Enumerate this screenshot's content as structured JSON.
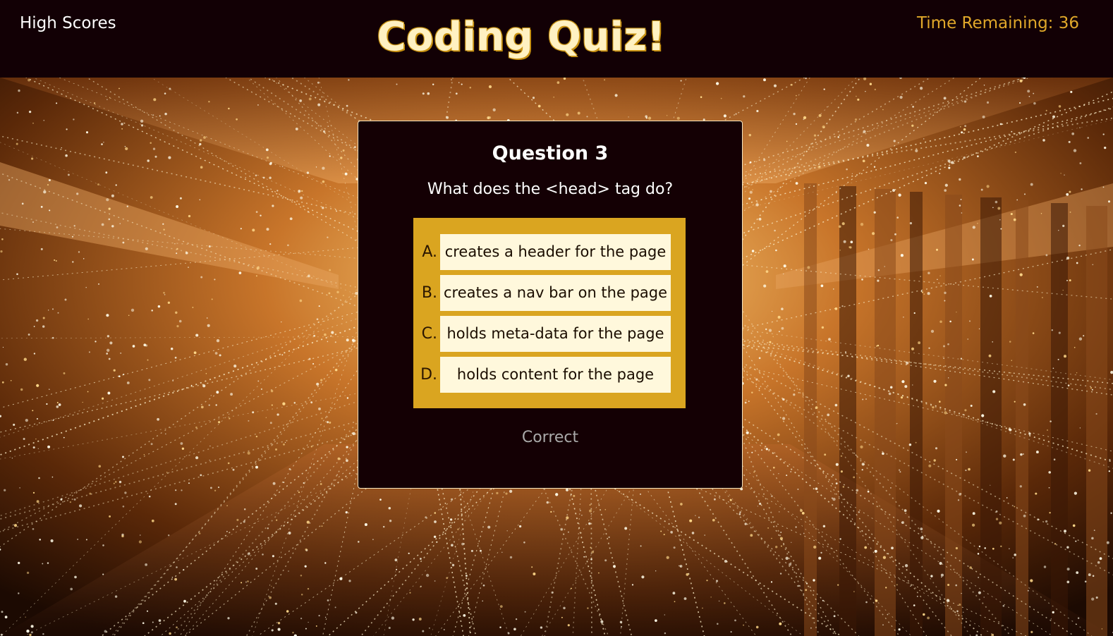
{
  "header": {
    "high_scores_label": "High Scores",
    "title": "Coding Quiz!",
    "timer_label": "Time Remaining: 36"
  },
  "quiz": {
    "question_number": "Question 3",
    "question_text": "What does the <head> tag do?",
    "answers": [
      {
        "letter": "A.",
        "text": "creates a header for the page"
      },
      {
        "letter": "B.",
        "text": "creates a nav bar on the page"
      },
      {
        "letter": "C.",
        "text": "holds meta-data for the page"
      },
      {
        "letter": "D.",
        "text": "holds content for the page"
      }
    ],
    "feedback": "Correct"
  },
  "colors": {
    "header_bg": "#120005",
    "card_bg": "#140004",
    "title_fill": "#fff1c2",
    "accent_gold": "#daa520",
    "timer_color": "#e0a82a",
    "answer_bg": "#fff8dc",
    "feedback_color": "#a9a9a9"
  }
}
